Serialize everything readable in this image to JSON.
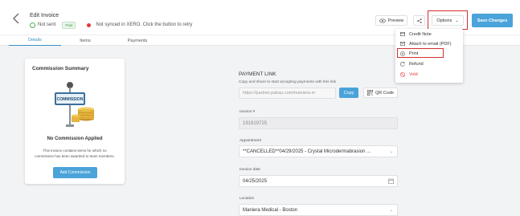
{
  "header": {
    "title": "Edit Invoice",
    "sent_status": "Not sent",
    "paid_badge": "Paid",
    "sync_status": "Not synced in XERO. Click the button to retry",
    "preview_label": "Preview",
    "options_label": "Options",
    "save_label": "Save Changes"
  },
  "tabs": [
    {
      "label": "Details",
      "active": true
    },
    {
      "label": "Items",
      "active": false
    },
    {
      "label": "Payments",
      "active": false
    }
  ],
  "options_menu": {
    "items": [
      {
        "label": "Credit Note",
        "icon": "credit-card-icon"
      },
      {
        "label": "Attach to email (PDF)",
        "icon": "mail-icon"
      },
      {
        "label": "Print",
        "icon": "print-icon"
      },
      {
        "label": "Refund",
        "icon": "refund-icon"
      },
      {
        "label": "Void",
        "icon": "void-icon"
      }
    ]
  },
  "commission": {
    "title": "Commission Summary",
    "sign_text": "COMMISSION",
    "none_title": "No Commission Applied",
    "none_desc": "This invoice contains items for which no commission has been awarded to team members.",
    "add_label": "Add Commission"
  },
  "payment_link": {
    "title": "PAYMENT LINK",
    "desc": "Copy and share to start accepting payments with this link",
    "url": "https://partner.pabau.com/maniera-m",
    "copy_label": "Copy",
    "qr_label": "QR Code"
  },
  "form": {
    "invoice_label": "Invoice #",
    "invoice_value": "191919725",
    "appointment_label": "Appointment",
    "appointment_value": "**CANCELLED**04/29/2025 - Crystal Microdermabrasion ...",
    "date_label": "Invoice date",
    "date_value": "04/25/2025",
    "location_label": "Location",
    "location_value": "Maniera Medical - Boston"
  },
  "colors": {
    "accent": "#4aa3d9",
    "highlight": "#d32f2f",
    "paid_green": "#3d9c47",
    "void_red": "#e53935"
  }
}
